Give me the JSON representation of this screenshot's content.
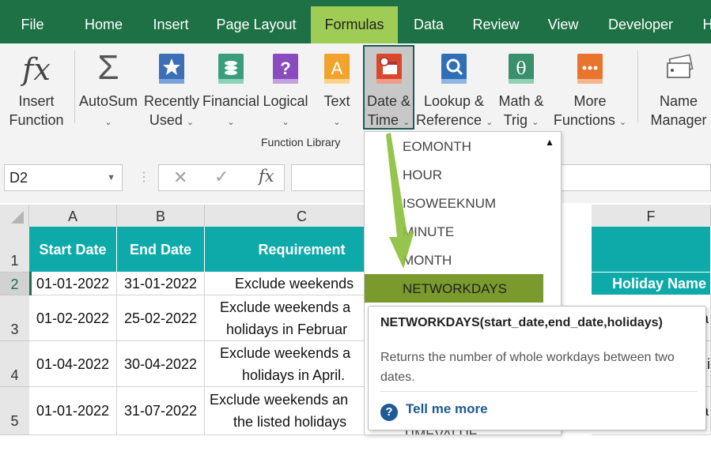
{
  "tabs": [
    "File",
    "Home",
    "Insert",
    "Page Layout",
    "Formulas",
    "Data",
    "Review",
    "View",
    "Developer",
    "H"
  ],
  "ribbon": {
    "insert_function": [
      "Insert",
      "Function"
    ],
    "autosum": "AutoSum",
    "recently_used": [
      "Recently",
      "Used"
    ],
    "financial": "Financial",
    "logical": "Logical",
    "text": "Text",
    "date_time": [
      "Date &",
      "Time"
    ],
    "lookup": [
      "Lookup &",
      "Reference"
    ],
    "math": [
      "Math &",
      "Trig"
    ],
    "more": [
      "More",
      "Functions"
    ],
    "name_manager": [
      "Name",
      "Manager"
    ],
    "group_label": "Function Library"
  },
  "formula_bar": {
    "name_box": "D2",
    "fx": "fx"
  },
  "columns": [
    "A",
    "B",
    "C",
    "F"
  ],
  "rows": [
    "1",
    "2",
    "3",
    "4",
    "5"
  ],
  "table": {
    "headers": [
      "Start Date",
      "End Date",
      "Requirement"
    ],
    "f_header": "Holiday Name",
    "rows": [
      [
        "01-01-2022",
        "31-01-2022",
        "Exclude weekends"
      ],
      [
        "01-02-2022",
        "25-02-2022",
        "Exclude weekends a",
        "holidays in Februar"
      ],
      [
        "01-04-2022",
        "30-04-2022",
        "Exclude weekends a",
        "holidays in April."
      ],
      [
        "01-01-2022",
        "31-07-2022",
        "Exclude weekends an",
        "the listed holidays"
      ]
    ],
    "f_partial": [
      "a",
      "Ki",
      "a"
    ]
  },
  "dropdown": {
    "items": [
      "EOMONTH",
      "HOUR",
      "ISOWEEKNUM",
      "MINUTE",
      "MONTH",
      "NETWORKDAYS",
      "TIMEVALUE"
    ],
    "selected": "NETWORKDAYS"
  },
  "tooltip": {
    "title": "NETWORKDAYS(start_date,end_date,holidays)",
    "description": "Returns the number of whole workdays between two dates.",
    "help": "Tell me more"
  },
  "colors": {
    "tabbar": "#1e7145",
    "active_tab": "#9fcc54",
    "header_fill": "#0eaaa9",
    "selected_item": "#7a9a2e",
    "arrow": "#8dc03f"
  }
}
